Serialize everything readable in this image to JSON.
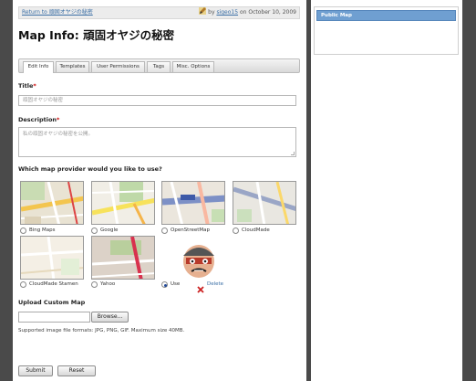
{
  "header": {
    "back_link": "Return to 頑固オヤジの秘密",
    "by": "by",
    "author": "sigeo15",
    "date_text": "on October 10, 2009"
  },
  "page_title": "Map Info: 頑固オヤジの秘密",
  "tabs": [
    {
      "label": "Edit Info",
      "active": true
    },
    {
      "label": "Templates",
      "active": false
    },
    {
      "label": "User Permissions",
      "active": false
    },
    {
      "label": "Tags",
      "active": false
    },
    {
      "label": "Misc. Options",
      "active": false
    }
  ],
  "form": {
    "title_label": "Title",
    "title_value": "頑固オヤジの秘密",
    "description_label": "Description",
    "description_value": "私の頑固オヤジの秘密を公開。",
    "required_mark": "*",
    "provider_question": "Which map provider would you like to use?",
    "providers": [
      {
        "label": "Bing Maps",
        "selected": false
      },
      {
        "label": "Google",
        "selected": false
      },
      {
        "label": "OpenStreetMap",
        "selected": false
      },
      {
        "label": "CloudMade",
        "selected": false
      },
      {
        "label": "CloudMade Stamen",
        "selected": false
      },
      {
        "label": "Yahoo",
        "selected": false
      }
    ],
    "custom_use_label": "Use",
    "custom_delete_label": "Delete",
    "custom_selected": true,
    "upload_label": "Upload Custom Map",
    "browse_label": "Browse...",
    "supported_formats": "Supported image file formats: JPG, PNG, GIF. Maximum size 40MB.",
    "submit_label": "Submit",
    "reset_label": "Reset"
  },
  "sidebar": {
    "public_map_label": "Public Map"
  },
  "colors": {
    "accent": "#6f9fd1",
    "link": "#3a6ea5",
    "required": "#cc0000",
    "delete": "#cc2222"
  }
}
